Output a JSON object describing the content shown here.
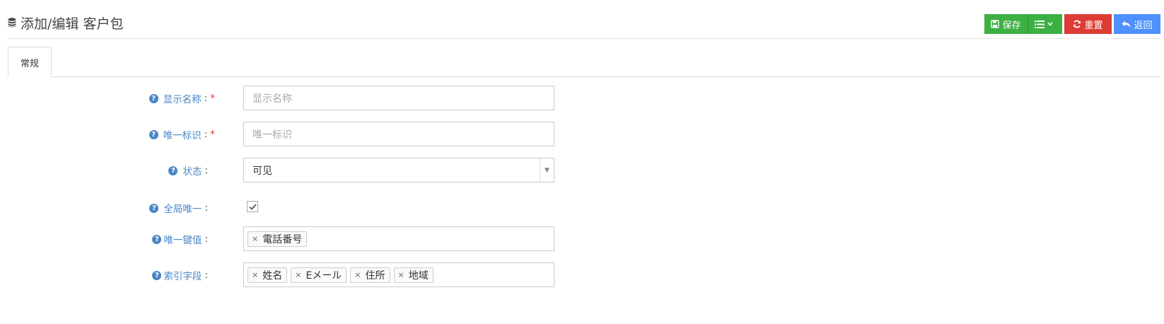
{
  "header": {
    "title": "添加/编辑 客户包",
    "buttons": {
      "save": "保存",
      "reset": "重置",
      "back": "返回"
    }
  },
  "tabs": [
    {
      "label": "常规"
    }
  ],
  "form": {
    "display_name": {
      "label": "显示名称",
      "placeholder": "显示名称",
      "required": "*"
    },
    "unique_id": {
      "label": "唯一标识",
      "placeholder": "唯一标识",
      "required": "*"
    },
    "status": {
      "label": "状态",
      "value": "可见"
    },
    "global_unique": {
      "label": "全局唯一",
      "checked": true
    },
    "unique_key": {
      "label": "唯一键值",
      "tags": [
        "電話番号"
      ]
    },
    "index_fields": {
      "label": "索引字段",
      "tags": [
        "姓名",
        "Eメール",
        "住所",
        "地域"
      ]
    }
  },
  "colors": {
    "save": "#3cb043",
    "reset": "#dd3d36",
    "back": "#4d90fe",
    "label": "#4a86c5",
    "required": "#e2312d"
  }
}
